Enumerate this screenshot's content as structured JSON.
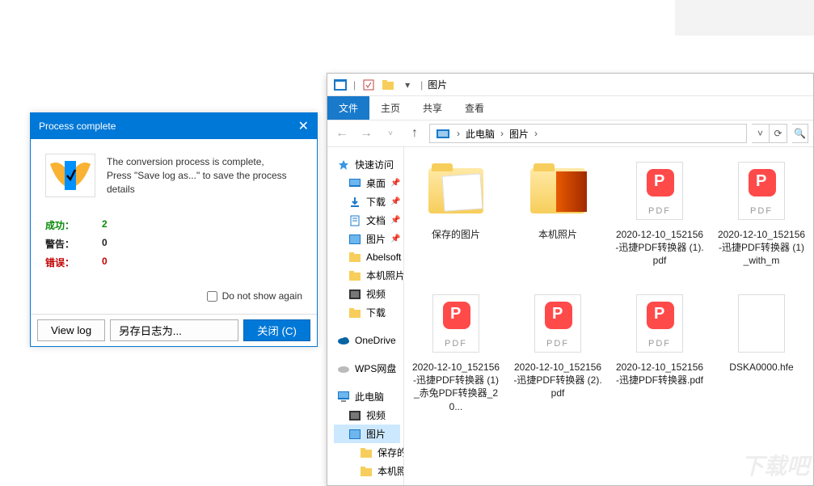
{
  "dialog": {
    "title": "Process complete",
    "message": "The conversion process is complete,\nPress \"Save log as...\" to save the process details",
    "stats": {
      "success_label": "成功：",
      "success_val": "2",
      "warn_label": "警告：",
      "warn_val": "0",
      "err_label": "错误：",
      "err_val": "0"
    },
    "dont_show": "Do not show again",
    "buttons": {
      "viewlog": "View log",
      "saveas": "另存日志为...",
      "close": "关闭 (C)"
    }
  },
  "explorer": {
    "title": "图片",
    "tabs": {
      "file": "文件",
      "home": "主页",
      "share": "共享",
      "view": "查看"
    },
    "breadcrumb": [
      "此电脑",
      "图片"
    ],
    "nav": {
      "quick": "快速访问",
      "desktop": "桌面",
      "downloads": "下载",
      "documents": "文档",
      "pictures": "图片",
      "abel": "Abelsoft Easy",
      "localphoto": "本机照片",
      "videos": "视频",
      "downloads2": "下载",
      "onedrive": "OneDrive",
      "wps": "WPS网盘",
      "thispc": "此电脑",
      "tpc_videos": "视频",
      "tpc_pictures": "图片",
      "saved": "保存的图片",
      "localphoto2": "本机照片"
    },
    "files": [
      {
        "name": "保存的图片",
        "kind": "folder-open"
      },
      {
        "name": "本机照片",
        "kind": "folder-photo"
      },
      {
        "name": "2020-12-10_152156-迅捷PDF转换器 (1).pdf",
        "kind": "pdf"
      },
      {
        "name": "2020-12-10_152156-迅捷PDF转换器 (1)_with_m",
        "kind": "pdf"
      },
      {
        "name": "2020-12-10_152156-迅捷PDF转换器 (1)_赤兔PDF转换器_20...",
        "kind": "pdf"
      },
      {
        "name": "2020-12-10_152156-迅捷PDF转换器 (2).pdf",
        "kind": "pdf"
      },
      {
        "name": "2020-12-10_152156-迅捷PDF转换器.pdf",
        "kind": "pdf"
      },
      {
        "name": "DSKA0000.hfe",
        "kind": "blank"
      }
    ]
  },
  "watermark": "下载吧"
}
